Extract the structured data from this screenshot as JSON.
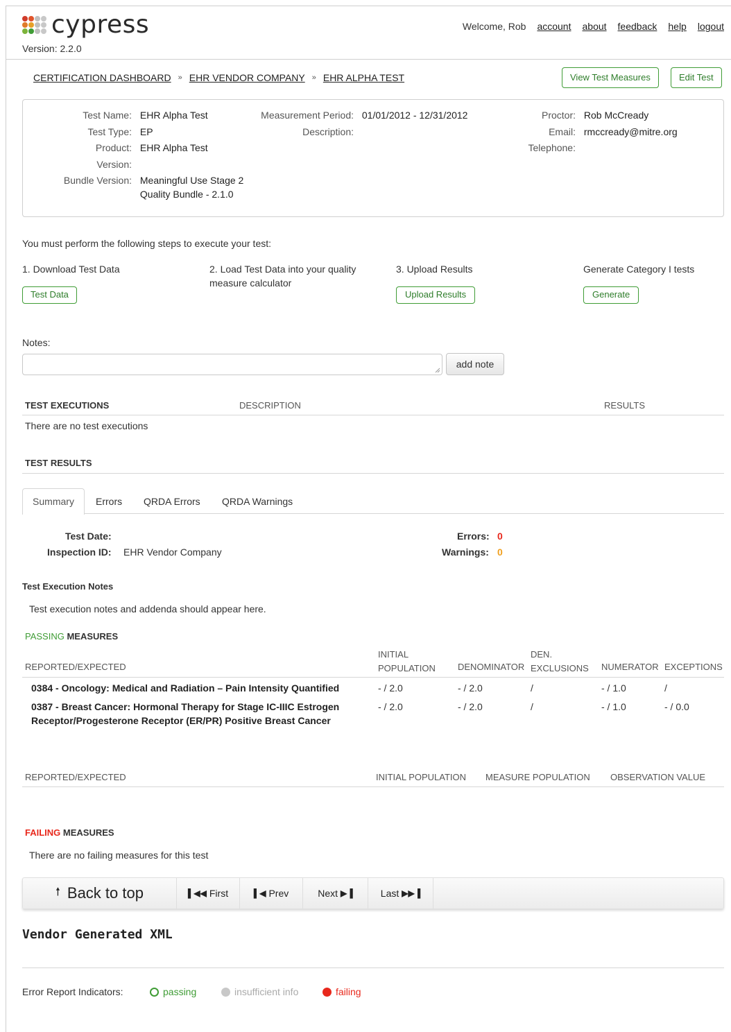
{
  "header": {
    "logo_text": "cypress",
    "version": "Version: 2.2.0",
    "welcome": "Welcome, Rob",
    "nav": [
      "account",
      "about",
      "feedback",
      "help",
      "logout"
    ]
  },
  "breadcrumb": {
    "items": [
      "CERTIFICATION DASHBOARD",
      "EHR VENDOR COMPANY",
      "EHR ALPHA TEST"
    ],
    "separator": "»"
  },
  "actions": {
    "view_measures": "View Test Measures",
    "edit_test": "Edit Test"
  },
  "test_info": {
    "test_name_label": "Test Name:",
    "test_name": "EHR Alpha Test",
    "test_type_label": "Test Type:",
    "test_type": "EP",
    "product_label": "Product:",
    "product": "EHR Alpha Test",
    "version_label": "Version:",
    "bundle_label": "Bundle Version:",
    "bundle_line1": "Meaningful Use Stage 2",
    "bundle_line2": "Quality Bundle - 2.1.0",
    "period_label": "Measurement Period:",
    "period": "01/01/2012 - 12/31/2012",
    "description_label": "Description:",
    "proctor_label": "Proctor:",
    "proctor": "Rob McCready",
    "email_label": "Email:",
    "email": "rmccready@mitre.org",
    "telephone_label": "Telephone:"
  },
  "steps": {
    "intro": "You must perform the following steps to execute your test:",
    "step1": "1. Download Test Data",
    "step1_button": "Test Data",
    "step2_line1": "2. Load Test Data into your quality",
    "step2_line2": "measure calculator",
    "step3": "3. Upload Results",
    "step3_button": "Upload Results",
    "step4": "Generate Category I tests",
    "step4_button": "Generate"
  },
  "notes": {
    "label": "Notes:",
    "add_button": "add note"
  },
  "executions": {
    "col1": "TEST EXECUTIONS",
    "col2": "DESCRIPTION",
    "col3": "RESULTS",
    "empty": "There are no test executions"
  },
  "results": {
    "heading": "TEST RESULTS",
    "tabs": [
      "Summary",
      "Errors",
      "QRDA Errors",
      "QRDA Warnings"
    ],
    "test_date_label": "Test Date:",
    "inspection_label": "Inspection ID:",
    "inspection_value": "EHR Vendor Company",
    "errors_label": "Errors:",
    "errors_value": "0",
    "warnings_label": "Warnings:",
    "warnings_value": "0",
    "notes_heading": "Test Execution Notes",
    "notes_text": "Test execution notes and addenda should appear here."
  },
  "passing": {
    "heading_colored": "PASSING",
    "heading_rest": " MEASURES",
    "col_reported": "REPORTED/EXPECTED",
    "col_ipp_1": "INITIAL",
    "col_ipp_2": "POPULATION",
    "col_den": "DENOMINATOR",
    "col_exc_1": "DEN.",
    "col_exc_2": "EXCLUSIONS",
    "col_num": "NUMERATOR",
    "col_exceptions": "EXCEPTIONS",
    "rows": [
      {
        "name_line1": "0384 - Oncology: Medical and Radiation – Pain Intensity Quantified",
        "name_line2": "",
        "ipp": "- / 2.0",
        "den": "- / 2.0",
        "exc": "/",
        "num": "- / 1.0",
        "exceptions": "/"
      },
      {
        "name_line1": "0387 - Breast Cancer: Hormonal Therapy for Stage IC-IIIC Estrogen",
        "name_line2": "Receptor/Progesterone Receptor (ER/PR) Positive Breast Cancer",
        "ipp": "- / 2.0",
        "den": "- / 2.0",
        "exc": "/",
        "num": "- / 1.0",
        "exceptions": "- / 0.0"
      }
    ]
  },
  "cv_table": {
    "col_reported": "REPORTED/EXPECTED",
    "col_ipp": "INITIAL POPULATION",
    "col_msrpopl": "MEASURE POPULATION",
    "col_observ": "OBSERVATION VALUE"
  },
  "failing": {
    "heading_colored": "FAILING",
    "heading_rest": " MEASURES",
    "empty": "There are no failing measures for this test"
  },
  "pager": {
    "back_to_top": "Back to top",
    "first": "First",
    "prev": "Prev",
    "next": "Next",
    "last": "Last"
  },
  "vendor_xml": {
    "heading": "Vendor Generated XML"
  },
  "legend": {
    "label": "Error Report Indicators:",
    "passing": "passing",
    "insufficient": "insufficient info",
    "failing": "failing"
  },
  "colors": {
    "green": "#3f9c35",
    "red": "#e8281c",
    "orange": "#f0a020",
    "gray_dot": "#c8c8c8"
  }
}
